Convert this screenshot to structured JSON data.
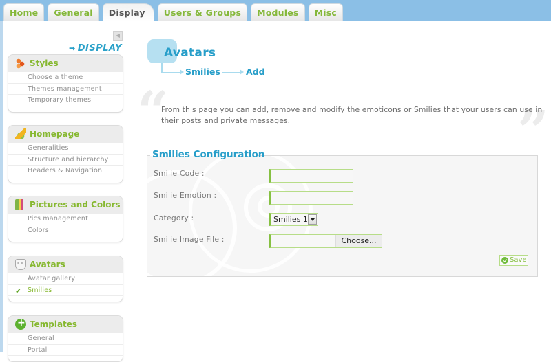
{
  "tabs": [
    {
      "label": "Home",
      "active": false
    },
    {
      "label": "General",
      "active": false
    },
    {
      "label": "Display",
      "active": true
    },
    {
      "label": "Users & Groups",
      "active": false
    },
    {
      "label": "Modules",
      "active": false
    },
    {
      "label": "Misc",
      "active": false
    }
  ],
  "sidebar": {
    "section_label": "DISPLAY",
    "section_arrow": "➡",
    "collapse_icon": "triangle-left-icon",
    "menus": [
      {
        "title": "Styles",
        "icon": "styles-icon",
        "items": [
          {
            "label": "Choose a theme"
          },
          {
            "label": "Themes management"
          },
          {
            "label": "Temporary themes"
          }
        ]
      },
      {
        "title": "Homepage",
        "icon": "homepage-icon",
        "items": [
          {
            "label": "Generalities"
          },
          {
            "label": "Structure and hierarchy"
          },
          {
            "label": "Headers & Navigation"
          }
        ]
      },
      {
        "title": "Pictures and Colors",
        "icon": "pictures-colors-icon",
        "items": [
          {
            "label": "Pics management"
          },
          {
            "label": "Colors"
          }
        ]
      },
      {
        "title": "Avatars",
        "icon": "avatar-mask-icon",
        "items": [
          {
            "label": "Avatar gallery"
          },
          {
            "label": "Smilies",
            "active": true,
            "check": "✔"
          }
        ]
      },
      {
        "title": "Templates",
        "icon": "plus-circle-icon",
        "items": [
          {
            "label": "General"
          },
          {
            "label": "Portal"
          }
        ]
      }
    ]
  },
  "breadcrumb": {
    "title": "Avatars",
    "level1": "Smilies",
    "level2": "Add"
  },
  "description": {
    "open_quote": "“",
    "close_quote": "”",
    "text": "From this page you can add, remove and modify the emoticons or Smilies that your users can use in their posts and private messages."
  },
  "form": {
    "legend": "Smilies Configuration",
    "fields": {
      "code": {
        "label": "Smilie Code :",
        "value": ""
      },
      "emotion": {
        "label": "Smilie Emotion :",
        "value": ""
      },
      "category": {
        "label": "Category :",
        "selected": "Smilies 1"
      },
      "image": {
        "label": "Smilie Image File :",
        "button": "Choose..."
      }
    },
    "save_label": "Save"
  }
}
